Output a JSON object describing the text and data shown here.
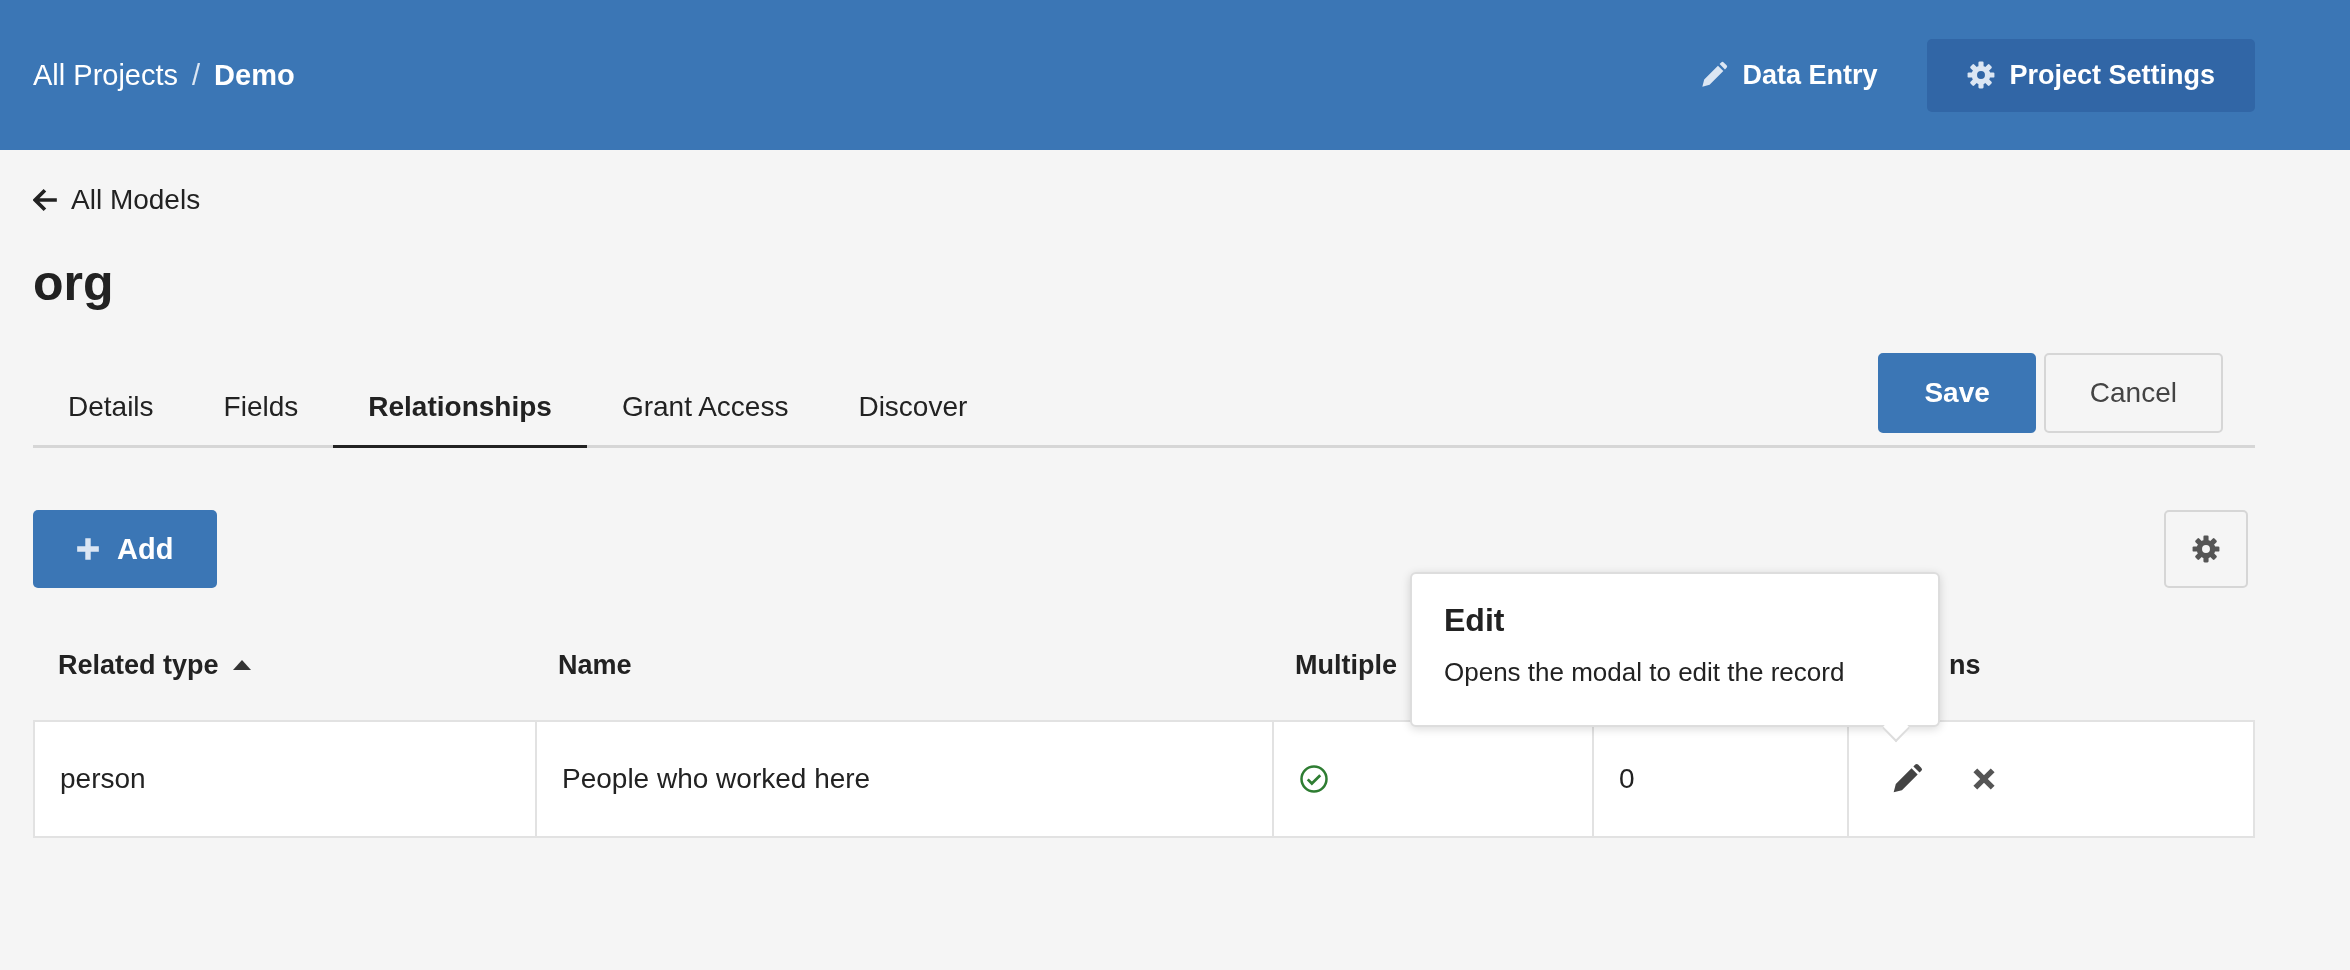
{
  "header": {
    "breadcrumb": [
      {
        "label": "All Projects",
        "current": false
      },
      {
        "label": "Demo",
        "current": true
      }
    ],
    "separator": "/",
    "nav": [
      {
        "label": "Data Entry",
        "kind": "pencil",
        "selected": false
      },
      {
        "label": "Project Settings",
        "kind": "gear",
        "selected": true
      }
    ]
  },
  "back_link": "All Models",
  "title": "org",
  "tabs": [
    {
      "label": "Details",
      "selected": false
    },
    {
      "label": "Fields",
      "selected": false
    },
    {
      "label": "Relationships",
      "selected": true
    },
    {
      "label": "Grant Access",
      "selected": false
    },
    {
      "label": "Discover",
      "selected": false
    }
  ],
  "form_actions": [
    {
      "label": "Save",
      "kind": "primary"
    },
    {
      "label": "Cancel",
      "kind": "secondary"
    }
  ],
  "add_button": {
    "label": "Add"
  },
  "table": {
    "columns": [
      {
        "label": "Related type",
        "sorted": true
      },
      {
        "label": "Name"
      },
      {
        "label": "Multiple"
      },
      {},
      {
        "label": "ns"
      }
    ],
    "rows": [
      {
        "related_type": "person",
        "name": "People who worked here",
        "multiple": true,
        "column_4": "0"
      }
    ]
  },
  "tooltip": {
    "title": "Edit",
    "text": "Opens the modal to edit the record"
  }
}
